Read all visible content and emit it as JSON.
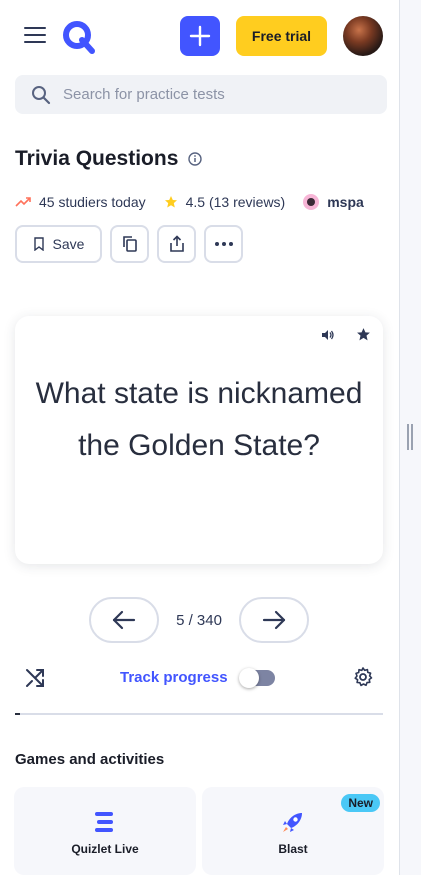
{
  "header": {
    "free_trial_label": "Free trial"
  },
  "search": {
    "placeholder": "Search for practice tests"
  },
  "set": {
    "title": "Trivia Questions",
    "studiers": "45 studiers today",
    "rating": "4.5 (13 reviews)",
    "author": "mspa"
  },
  "actions": {
    "save_label": "Save"
  },
  "card": {
    "question": "What state is nicknamed the Golden State?"
  },
  "navigation": {
    "counter": "5 / 340"
  },
  "controls": {
    "track_progress_label": "Track progress",
    "track_progress_on": false
  },
  "progress": {
    "current": 5,
    "total": 340
  },
  "games": {
    "section_title": "Games and activities",
    "items": [
      {
        "label": "Quizlet Live",
        "icon": "quizlet-live-icon"
      },
      {
        "label": "Blast",
        "icon": "rocket-icon",
        "badge": "New"
      }
    ]
  },
  "colors": {
    "primary": "#4255ff",
    "trial": "#ffcd1f",
    "new_badge": "#4ac8f6",
    "star": "#ffcd1f"
  }
}
